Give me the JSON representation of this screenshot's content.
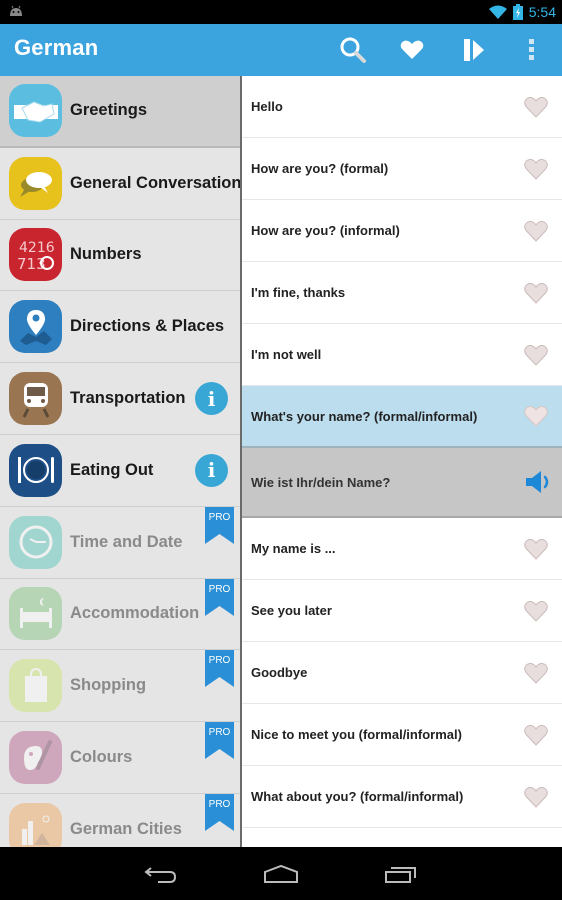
{
  "status_bar": {
    "time": "5:54",
    "icons": [
      "android-icon",
      "wifi-icon",
      "battery-charging-icon"
    ]
  },
  "action_bar": {
    "title": "German",
    "actions": [
      {
        "name": "search",
        "icon": "search-icon"
      },
      {
        "name": "favorites",
        "icon": "heart-icon"
      },
      {
        "name": "play",
        "icon": "play-icon"
      },
      {
        "name": "overflow",
        "icon": "overflow-menu-icon"
      }
    ]
  },
  "categories": [
    {
      "label": "Greetings",
      "icon": "handshake-icon",
      "color": "#5bbde0",
      "selected": true,
      "badge": ""
    },
    {
      "label": "General Conversation",
      "icon": "speech-bubbles-icon",
      "color": "#e7c21c",
      "selected": false,
      "badge": ""
    },
    {
      "label": "Numbers",
      "icon": "numbers-icon",
      "color": "#c9252f",
      "selected": false,
      "badge": ""
    },
    {
      "label": "Directions & Places",
      "icon": "map-pin-icon",
      "color": "#2d7fbf",
      "selected": false,
      "badge": ""
    },
    {
      "label": "Transportation",
      "icon": "train-icon",
      "color": "#9a7552",
      "selected": false,
      "badge": "info"
    },
    {
      "label": "Eating Out",
      "icon": "plate-cutlery-icon",
      "color": "#1d4f86",
      "selected": false,
      "badge": "info"
    },
    {
      "label": "Time and Date",
      "icon": "clock-icon",
      "color": "#4ec4b5",
      "selected": false,
      "badge": "PRO"
    },
    {
      "label": "Accommodation",
      "icon": "bed-icon",
      "color": "#7ec27c",
      "selected": false,
      "badge": "PRO"
    },
    {
      "label": "Shopping",
      "icon": "shopping-bag-icon",
      "color": "#c9e36a",
      "selected": false,
      "badge": "PRO"
    },
    {
      "label": "Colours",
      "icon": "palette-icon",
      "color": "#b55d8c",
      "selected": false,
      "badge": "PRO"
    },
    {
      "label": "German Cities",
      "icon": "city-icon",
      "color": "#f2a65a",
      "selected": false,
      "badge": "PRO"
    }
  ],
  "info_badge_text": "i",
  "pro_badge_text": "PRO",
  "phrases": [
    {
      "text": "Hello",
      "state": "normal"
    },
    {
      "text": "How are you? (formal)",
      "state": "normal"
    },
    {
      "text": "How are you? (informal)",
      "state": "normal"
    },
    {
      "text": "I'm fine, thanks",
      "state": "normal"
    },
    {
      "text": "I'm not well",
      "state": "normal"
    },
    {
      "text": "What's your name? (formal/informal)",
      "state": "active"
    },
    {
      "text": "Wie ist Ihr/dein Name?",
      "state": "translation"
    },
    {
      "text": "My name is ...",
      "state": "normal"
    },
    {
      "text": "See you later",
      "state": "normal"
    },
    {
      "text": "Goodbye",
      "state": "normal"
    },
    {
      "text": "Nice to meet you (formal/informal)",
      "state": "normal"
    },
    {
      "text": "What about you? (formal/informal)",
      "state": "normal"
    },
    {
      "text": "",
      "state": "normal"
    }
  ],
  "nav_bar": {
    "buttons": [
      "back",
      "home",
      "recent-apps"
    ]
  },
  "colors": {
    "accent": "#3ba3dd",
    "status_time": "#33b5e5",
    "active_row": "#bcdded",
    "translation_row": "#c6c6c6",
    "pro_ribbon": "#2a8fd6"
  }
}
